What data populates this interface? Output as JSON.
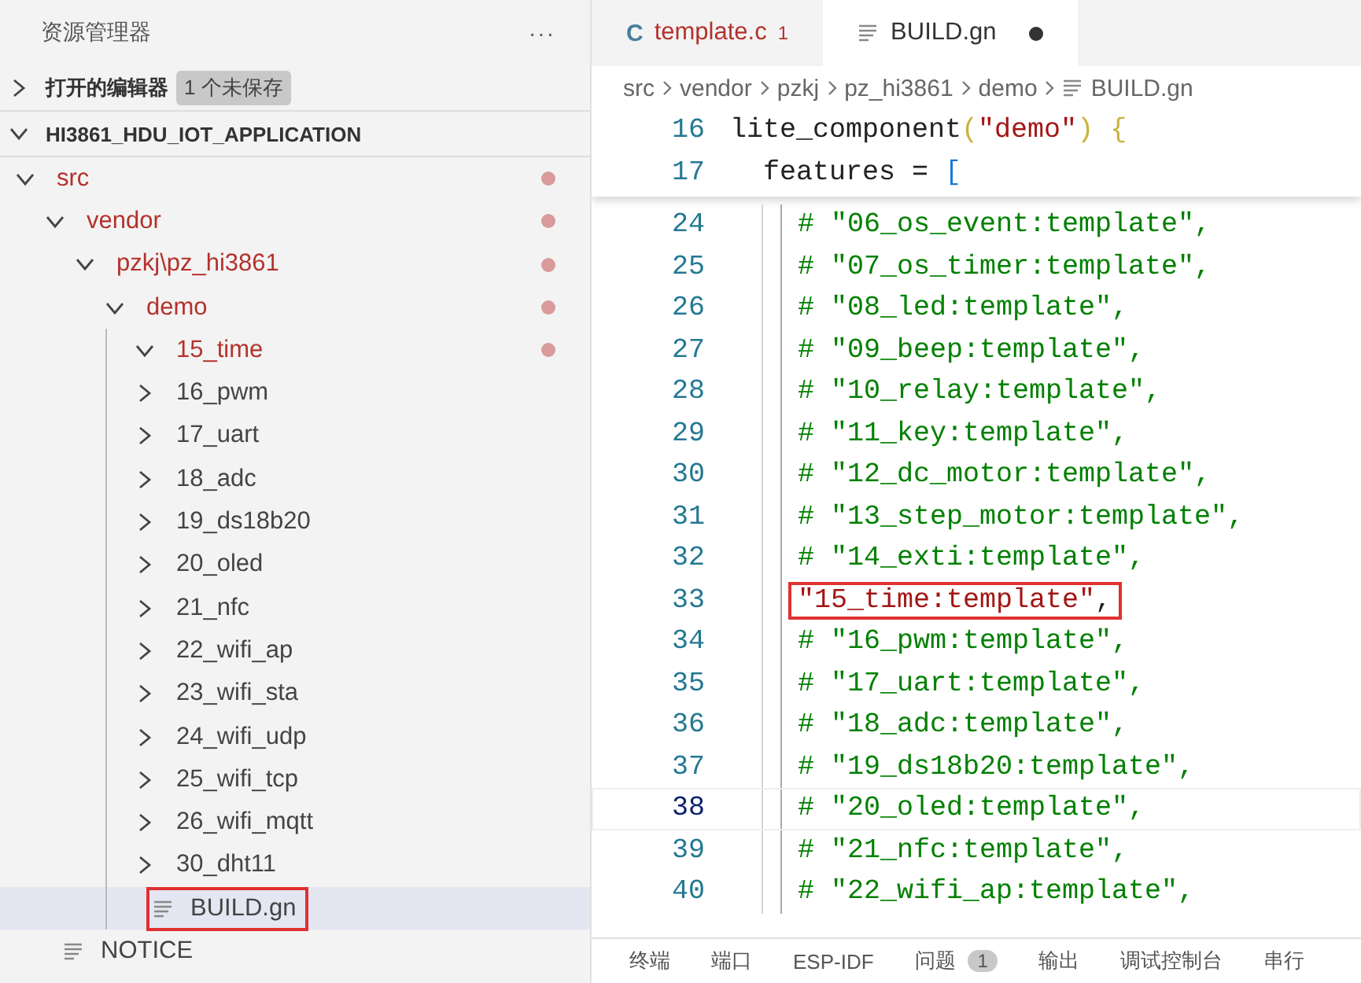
{
  "explorer": {
    "title": "资源管理器",
    "more": "···",
    "open_editors": {
      "label": "打开的编辑器",
      "expanded": false,
      "badge": "1 个未保存"
    },
    "project": {
      "label": "HI3861_HDU_IOT_APPLICATION",
      "expanded": true
    },
    "tree": [
      {
        "label": "src",
        "kind": "folder",
        "expanded": true,
        "modified": true,
        "selected": false,
        "highlighted": false,
        "children": [
          {
            "label": "vendor",
            "kind": "folder",
            "expanded": true,
            "modified": true,
            "selected": false,
            "highlighted": false,
            "children": [
              {
                "label": "pzkj\\pz_hi3861",
                "kind": "folder",
                "expanded": true,
                "modified": true,
                "selected": false,
                "highlighted": false,
                "children": [
                  {
                    "label": "demo",
                    "kind": "folder",
                    "expanded": true,
                    "modified": true,
                    "selected": false,
                    "highlighted": false,
                    "children": [
                      {
                        "label": "15_time",
                        "kind": "folder",
                        "expanded": true,
                        "modified": true,
                        "selected": false,
                        "highlighted": false
                      },
                      {
                        "label": "16_pwm",
                        "kind": "folder",
                        "expanded": false,
                        "modified": false,
                        "selected": false,
                        "highlighted": false
                      },
                      {
                        "label": "17_uart",
                        "kind": "folder",
                        "expanded": false,
                        "modified": false,
                        "selected": false,
                        "highlighted": false
                      },
                      {
                        "label": "18_adc",
                        "kind": "folder",
                        "expanded": false,
                        "modified": false,
                        "selected": false,
                        "highlighted": false
                      },
                      {
                        "label": "19_ds18b20",
                        "kind": "folder",
                        "expanded": false,
                        "modified": false,
                        "selected": false,
                        "highlighted": false
                      },
                      {
                        "label": "20_oled",
                        "kind": "folder",
                        "expanded": false,
                        "modified": false,
                        "selected": false,
                        "highlighted": false
                      },
                      {
                        "label": "21_nfc",
                        "kind": "folder",
                        "expanded": false,
                        "modified": false,
                        "selected": false,
                        "highlighted": false
                      },
                      {
                        "label": "22_wifi_ap",
                        "kind": "folder",
                        "expanded": false,
                        "modified": false,
                        "selected": false,
                        "highlighted": false
                      },
                      {
                        "label": "23_wifi_sta",
                        "kind": "folder",
                        "expanded": false,
                        "modified": false,
                        "selected": false,
                        "highlighted": false
                      },
                      {
                        "label": "24_wifi_udp",
                        "kind": "folder",
                        "expanded": false,
                        "modified": false,
                        "selected": false,
                        "highlighted": false
                      },
                      {
                        "label": "25_wifi_tcp",
                        "kind": "folder",
                        "expanded": false,
                        "modified": false,
                        "selected": false,
                        "highlighted": false
                      },
                      {
                        "label": "26_wifi_mqtt",
                        "kind": "folder",
                        "expanded": false,
                        "modified": false,
                        "selected": false,
                        "highlighted": false
                      },
                      {
                        "label": "30_dht11",
                        "kind": "folder",
                        "expanded": false,
                        "modified": false,
                        "selected": false,
                        "highlighted": false
                      },
                      {
                        "label": "BUILD.gn",
                        "kind": "file",
                        "modified": false,
                        "selected": true,
                        "highlighted": true
                      }
                    ]
                  }
                ]
              }
            ]
          },
          {
            "label": "NOTICE",
            "kind": "file",
            "modified": false,
            "selected": false,
            "highlighted": false
          }
        ]
      }
    ]
  },
  "editor": {
    "tabs": [
      {
        "icon": "C",
        "label": "template.c",
        "problems": "1",
        "selected": false,
        "dirty": false
      },
      {
        "label": "BUILD.gn",
        "selected": true,
        "dirty": true
      }
    ],
    "breadcrumb": [
      "src",
      "vendor",
      "pzkj",
      "pz_hi3861",
      "demo",
      "BUILD.gn"
    ],
    "sticky_lines": [
      {
        "number": "16",
        "tokens": [
          {
            "kind": "name",
            "text": "lite_component"
          },
          {
            "kind": "paren",
            "text": "("
          },
          {
            "kind": "string",
            "text": "\"demo\""
          },
          {
            "kind": "paren",
            "text": ")"
          },
          {
            "kind": "brace",
            "text": "{"
          }
        ]
      },
      {
        "number": "17",
        "tokens": [
          {
            "kind": "member",
            "text": "features"
          },
          {
            "kind": "operator",
            "text": "="
          },
          {
            "kind": "bracket",
            "text": "["
          }
        ]
      }
    ],
    "lines": [
      {
        "number": "24",
        "kind": "comment",
        "text": "# \"06_os_event:template\",",
        "current": false,
        "highlighted": false
      },
      {
        "number": "25",
        "kind": "comment",
        "text": "# \"07_os_timer:template\",",
        "current": false,
        "highlighted": false
      },
      {
        "number": "26",
        "kind": "comment",
        "text": "# \"08_led:template\",",
        "current": false,
        "highlighted": false
      },
      {
        "number": "27",
        "kind": "comment",
        "text": "# \"09_beep:template\",",
        "current": false,
        "highlighted": false
      },
      {
        "number": "28",
        "kind": "comment",
        "text": "# \"10_relay:template\",",
        "current": false,
        "highlighted": false
      },
      {
        "number": "29",
        "kind": "comment",
        "text": "# \"11_key:template\",",
        "current": false,
        "highlighted": false
      },
      {
        "number": "30",
        "kind": "comment",
        "text": "# \"12_dc_motor:template\",",
        "current": false,
        "highlighted": false
      },
      {
        "number": "31",
        "kind": "comment",
        "text": "# \"13_step_motor:template\",",
        "current": false,
        "highlighted": false
      },
      {
        "number": "32",
        "kind": "comment",
        "text": "# \"14_exti:template\",",
        "current": false,
        "highlighted": false
      },
      {
        "number": "33",
        "kind": "tokens",
        "tokens": [
          {
            "kind": "string",
            "text": "\"15_time:template\""
          },
          {
            "kind": "punct",
            "text": ","
          }
        ],
        "current": false,
        "highlighted": true
      },
      {
        "number": "34",
        "kind": "comment",
        "text": "# \"16_pwm:template\",",
        "current": false,
        "highlighted": false
      },
      {
        "number": "35",
        "kind": "comment",
        "text": "# \"17_uart:template\",",
        "current": false,
        "highlighted": false
      },
      {
        "number": "36",
        "kind": "comment",
        "text": "# \"18_adc:template\",",
        "current": false,
        "highlighted": false
      },
      {
        "number": "37",
        "kind": "comment",
        "text": "# \"19_ds18b20:template\",",
        "current": false,
        "highlighted": false
      },
      {
        "number": "38",
        "kind": "comment",
        "text": "# \"20_oled:template\",",
        "current": true,
        "highlighted": false
      },
      {
        "number": "39",
        "kind": "comment",
        "text": "# \"21_nfc:template\",",
        "current": false,
        "highlighted": false
      },
      {
        "number": "40",
        "kind": "comment",
        "text": "# \"22_wifi_ap:template\",",
        "current": false,
        "highlighted": false
      }
    ]
  },
  "panel": {
    "tabs": [
      {
        "label": "终端"
      },
      {
        "label": "端口"
      },
      {
        "label": "ESP-IDF"
      },
      {
        "label": "问题",
        "badge": "1"
      },
      {
        "label": "输出"
      },
      {
        "label": "调试控制台"
      },
      {
        "label": "串行"
      }
    ]
  }
}
